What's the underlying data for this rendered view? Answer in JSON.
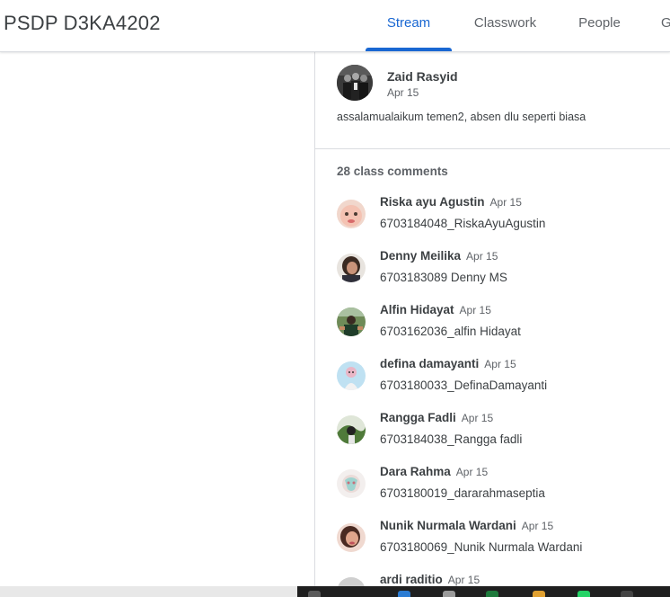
{
  "header": {
    "class_title": "PSDP D3KA4202",
    "tabs": [
      {
        "label": "Stream",
        "active": true
      },
      {
        "label": "Classwork",
        "active": false
      },
      {
        "label": "People",
        "active": false
      },
      {
        "label": "G",
        "active": false
      }
    ]
  },
  "post": {
    "author": "Zaid Rasyid",
    "date": "Apr 15",
    "body": "assalamualaikum temen2, absen dlu seperti biasa"
  },
  "comments_count": "28 class comments",
  "comments": [
    {
      "name": "Riska ayu Agustin",
      "date": "Apr 15",
      "text": "6703184048_RiskaAyuAgustin"
    },
    {
      "name": "Denny Meilika",
      "date": "Apr 15",
      "text": "6703183089 Denny MS"
    },
    {
      "name": "Alfin Hidayat",
      "date": "Apr 15",
      "text": "6703162036_alfin Hidayat"
    },
    {
      "name": "defina damayanti",
      "date": "Apr 15",
      "text": "6703180033_DefinaDamayanti"
    },
    {
      "name": "Rangga Fadli",
      "date": "Apr 15",
      "text": "6703184038_Rangga fadli"
    },
    {
      "name": "Dara Rahma",
      "date": "Apr 15",
      "text": "6703180019_dararahmaseptia"
    },
    {
      "name": "Nunik Nurmala Wardani",
      "date": "Apr 15",
      "text": "6703180069_Nunik Nurmala Wardani"
    },
    {
      "name": "ardi raditio",
      "date": "Apr 15",
      "text": ""
    }
  ],
  "colors": {
    "accent": "#1967d2",
    "text": "#3c4043",
    "muted": "#5f6368",
    "divider": "#dadce0"
  }
}
